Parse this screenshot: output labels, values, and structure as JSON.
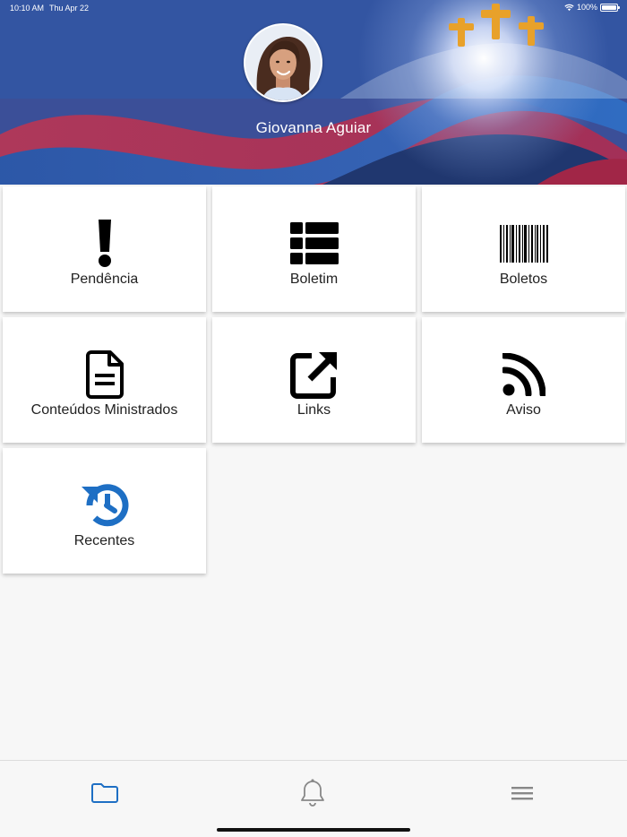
{
  "status_bar": {
    "time": "10:10 AM",
    "date": "Thu Apr 22",
    "battery": "100%"
  },
  "profile": {
    "name": "Giovanna Aguiar"
  },
  "menu": {
    "items": [
      {
        "label": "Pendência",
        "icon": "exclamation-icon"
      },
      {
        "label": "Boletim",
        "icon": "table-list-icon"
      },
      {
        "label": "Boletos",
        "icon": "barcode-icon"
      },
      {
        "label": "Conteúdos Ministrados",
        "icon": "document-icon"
      },
      {
        "label": "Links",
        "icon": "external-link-icon"
      },
      {
        "label": "Aviso",
        "icon": "rss-icon"
      },
      {
        "label": "Recentes",
        "icon": "history-icon"
      }
    ]
  },
  "bottom_nav": {
    "tabs": [
      {
        "icon": "folder-icon",
        "active": true
      },
      {
        "icon": "bell-icon",
        "active": false
      },
      {
        "icon": "hamburger-menu-icon",
        "active": false
      }
    ]
  },
  "colors": {
    "accent": "#1e6fc4",
    "tile_bg": "#ffffff",
    "page_bg": "#f7f7f7",
    "text": "#222222",
    "inactive_icon": "#888888"
  }
}
